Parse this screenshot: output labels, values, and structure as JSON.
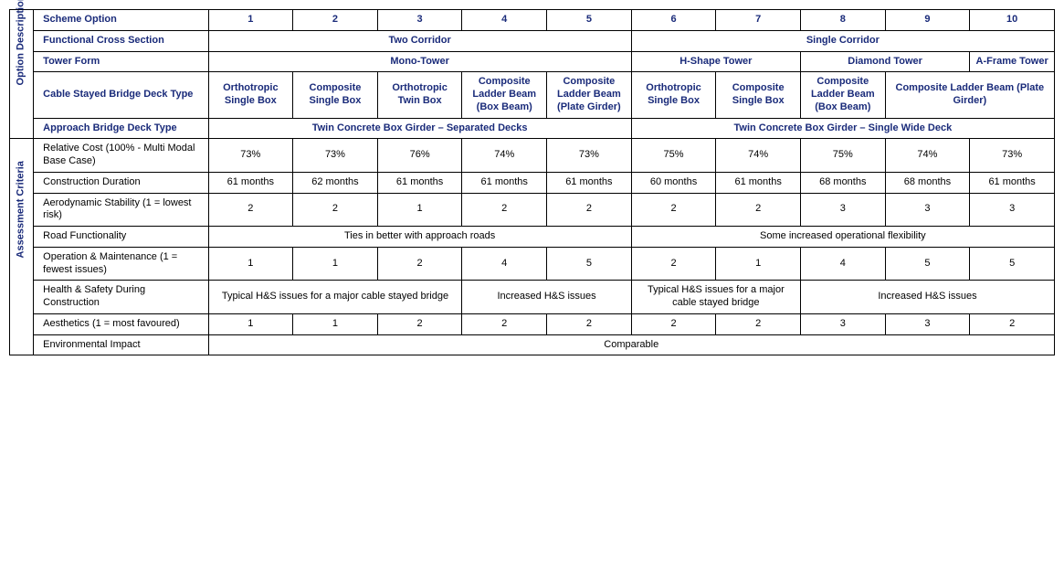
{
  "side": {
    "desc": "Option Description",
    "assess": "Assessment Criteria"
  },
  "hdr": {
    "scheme": "Scheme Option",
    "fcs": "Functional Cross Section",
    "tower": "Tower Form",
    "deck": "Cable Stayed Bridge Deck Type",
    "approach": "Approach Bridge Deck Type"
  },
  "opts": [
    "1",
    "2",
    "3",
    "4",
    "5",
    "6",
    "7",
    "8",
    "9",
    "10"
  ],
  "fcs": {
    "a": "Two Corridor",
    "b": "Single Corridor"
  },
  "tower": {
    "a": "Mono-Tower",
    "b": "H-Shape Tower",
    "c": "Diamond Tower",
    "d": "A-Frame Tower"
  },
  "deck": {
    "d1": "Orthotropic Single Box",
    "d2": "Composite Single Box",
    "d3": "Orthotropic Twin Box",
    "d4": "Composite Ladder Beam (Box Beam)",
    "d5": "Composite Ladder Beam (Plate Girder)",
    "d6": "Orthotropic Single Box",
    "d7": "Composite Single Box",
    "d8": "Composite Ladder Beam (Box Beam)",
    "d9": "Composite Ladder Beam (Plate Girder)"
  },
  "approach": {
    "a": "Twin Concrete Box Girder – Separated Decks",
    "b": "Twin Concrete Box Girder – Single Wide Deck"
  },
  "rows": {
    "cost": {
      "label": "Relative Cost\n(100% - Multi Modal Base Case)",
      "v": [
        "73%",
        "73%",
        "76%",
        "74%",
        "73%",
        "75%",
        "74%",
        "75%",
        "74%",
        "73%"
      ]
    },
    "dur": {
      "label": "Construction Duration",
      "v": [
        "61 months",
        "62 months",
        "61 months",
        "61 months",
        "61 months",
        "60 months",
        "61 months",
        "68 months",
        "68 months",
        "61 months"
      ]
    },
    "aero": {
      "label": "Aerodynamic Stability\n(1 = lowest risk)",
      "v": [
        "2",
        "2",
        "1",
        "2",
        "2",
        "2",
        "2",
        "3",
        "3",
        "3"
      ]
    },
    "road": {
      "label": "Road Functionality",
      "a": "Ties in better with approach roads",
      "b": "Some increased operational flexibility"
    },
    "om": {
      "label": "Operation & Maintenance\n(1 = fewest issues)",
      "v": [
        "1",
        "1",
        "2",
        "4",
        "5",
        "2",
        "1",
        "4",
        "5",
        "5"
      ]
    },
    "hs": {
      "label": "Health & Safety During Construction",
      "a": "Typical H&S issues for a major cable stayed bridge",
      "b": "Increased H&S issues",
      "c": "Typical H&S issues for a major cable stayed bridge",
      "d": "Increased H&S issues"
    },
    "aes": {
      "label": "Aesthetics\n(1 = most favoured)",
      "v": [
        "1",
        "1",
        "2",
        "2",
        "2",
        "2",
        "2",
        "3",
        "3",
        "2"
      ]
    },
    "env": {
      "label": "Environmental Impact",
      "a": "Comparable"
    }
  }
}
